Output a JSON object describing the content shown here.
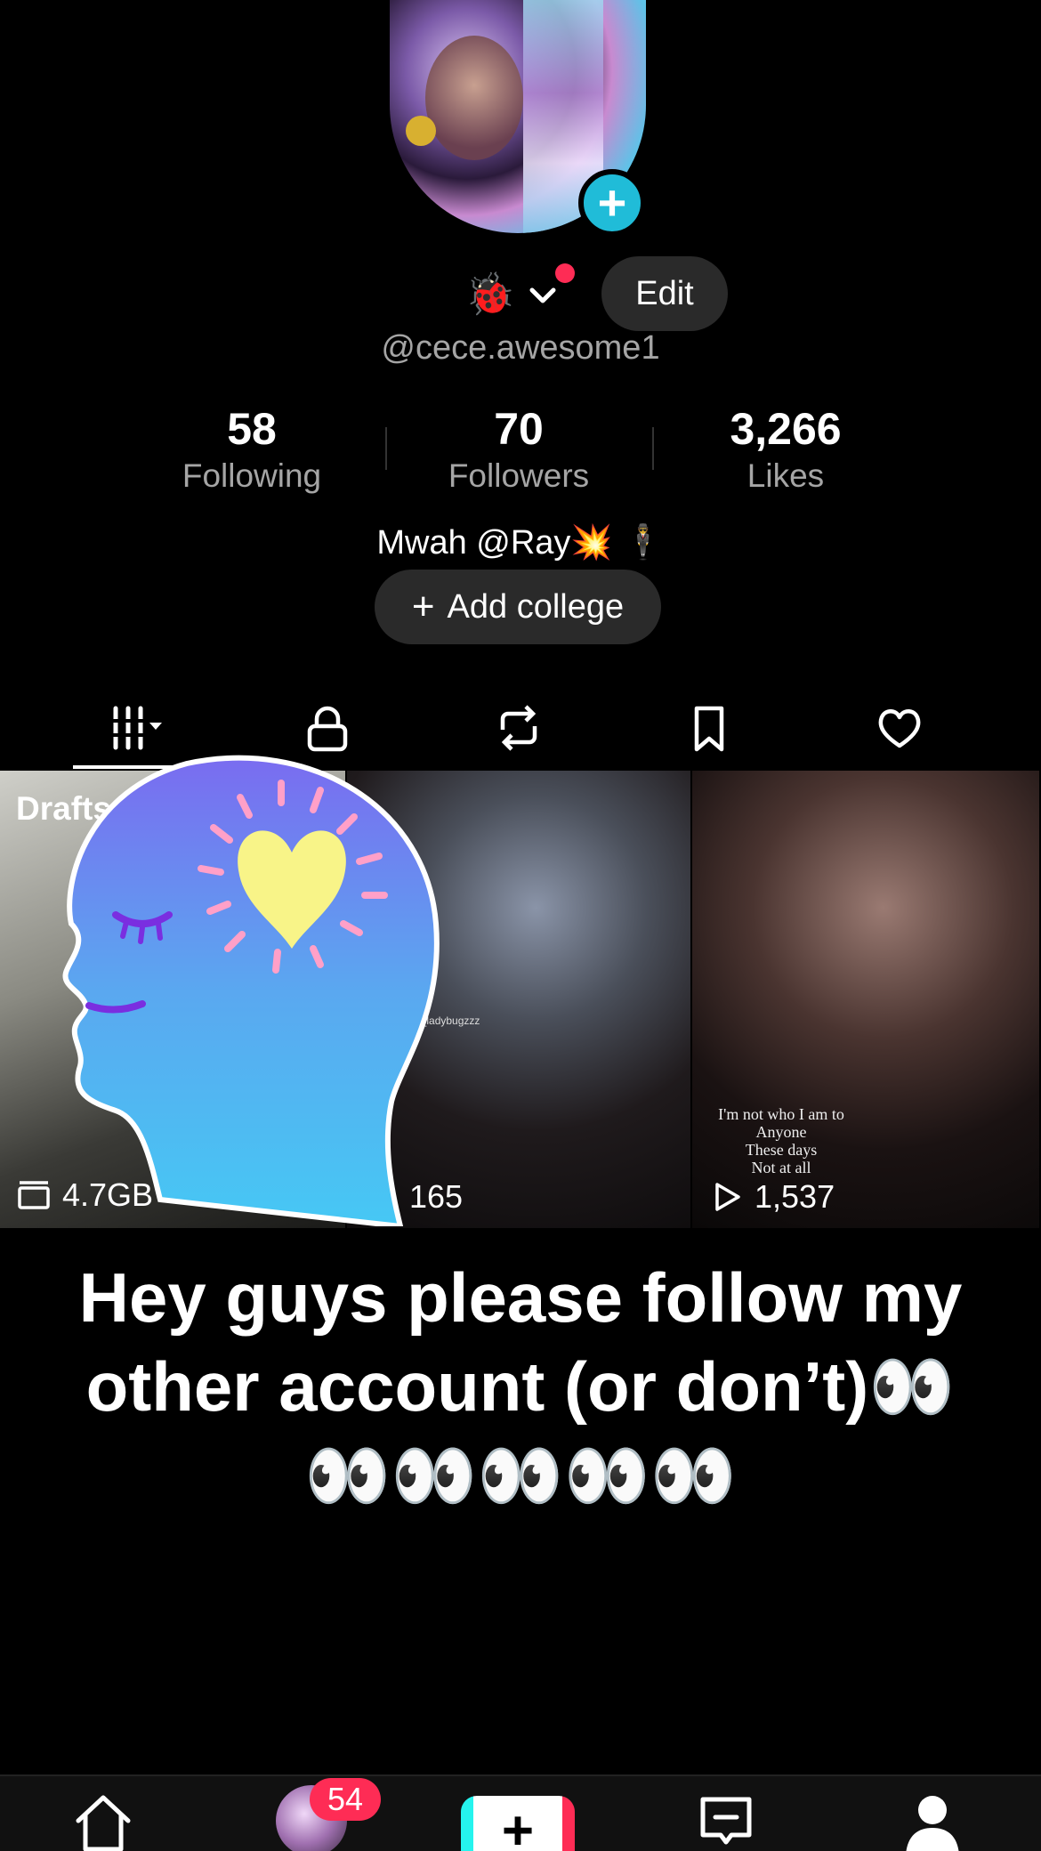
{
  "profile": {
    "name_emoji": "🐞",
    "edit_label": "Edit",
    "username": "@cece.awesome1",
    "bio": "Mwah @Ray💥 🕴",
    "add_college_label": "Add college"
  },
  "stats": [
    {
      "value": "58",
      "label": "Following"
    },
    {
      "value": "70",
      "label": "Followers"
    },
    {
      "value": "3,266",
      "label": "Likes"
    }
  ],
  "tabs": [
    {
      "icon": "grid-icon"
    },
    {
      "icon": "lock-icon"
    },
    {
      "icon": "repost-icon"
    },
    {
      "icon": "bookmark-icon"
    },
    {
      "icon": "heart-icon"
    }
  ],
  "grid": [
    {
      "label": "Drafts:",
      "meta": "4.7GB",
      "meta_icon": "storage-icon"
    },
    {
      "tag": "the_ladybugzzz",
      "meta": "165",
      "meta_icon": "play-icon"
    },
    {
      "caption": [
        "I'm not who I am to",
        "Anyone",
        "These days",
        "Not at all"
      ],
      "meta": "1,537",
      "meta_icon": "play-icon"
    }
  ],
  "overlay_caption": "Hey guys please follow my other account (or don’t)👀👀👀👀👀👀",
  "bottom_nav": {
    "inbox_badge": "54"
  },
  "colors": {
    "accent": "#20bcd8",
    "notification": "#fe2c55",
    "pill_bg": "#2a2a2a",
    "muted_text": "#a5a5a5"
  }
}
